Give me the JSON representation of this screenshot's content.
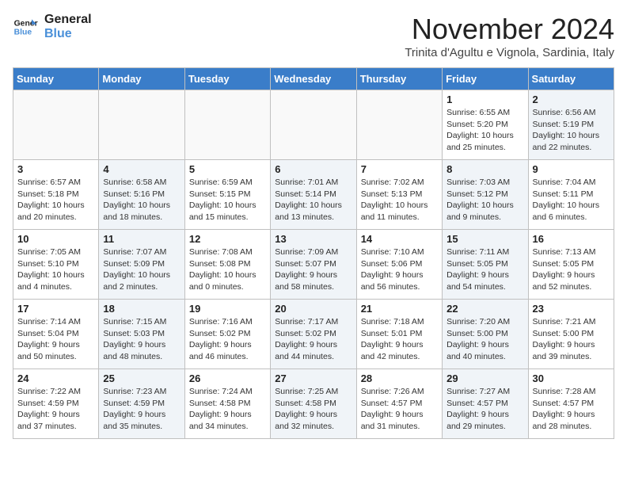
{
  "logo": {
    "line1": "General",
    "line2": "Blue"
  },
  "title": "November 2024",
  "subtitle": "Trinita d'Agultu e Vignola, Sardinia, Italy",
  "headers": [
    "Sunday",
    "Monday",
    "Tuesday",
    "Wednesday",
    "Thursday",
    "Friday",
    "Saturday"
  ],
  "weeks": [
    [
      {
        "day": "",
        "info": "",
        "shaded": false,
        "empty": true
      },
      {
        "day": "",
        "info": "",
        "shaded": false,
        "empty": true
      },
      {
        "day": "",
        "info": "",
        "shaded": false,
        "empty": true
      },
      {
        "day": "",
        "info": "",
        "shaded": false,
        "empty": true
      },
      {
        "day": "",
        "info": "",
        "shaded": false,
        "empty": true
      },
      {
        "day": "1",
        "info": "Sunrise: 6:55 AM\nSunset: 5:20 PM\nDaylight: 10 hours and 25 minutes.",
        "shaded": false,
        "empty": false
      },
      {
        "day": "2",
        "info": "Sunrise: 6:56 AM\nSunset: 5:19 PM\nDaylight: 10 hours and 22 minutes.",
        "shaded": true,
        "empty": false
      }
    ],
    [
      {
        "day": "3",
        "info": "Sunrise: 6:57 AM\nSunset: 5:18 PM\nDaylight: 10 hours and 20 minutes.",
        "shaded": false,
        "empty": false
      },
      {
        "day": "4",
        "info": "Sunrise: 6:58 AM\nSunset: 5:16 PM\nDaylight: 10 hours and 18 minutes.",
        "shaded": true,
        "empty": false
      },
      {
        "day": "5",
        "info": "Sunrise: 6:59 AM\nSunset: 5:15 PM\nDaylight: 10 hours and 15 minutes.",
        "shaded": false,
        "empty": false
      },
      {
        "day": "6",
        "info": "Sunrise: 7:01 AM\nSunset: 5:14 PM\nDaylight: 10 hours and 13 minutes.",
        "shaded": true,
        "empty": false
      },
      {
        "day": "7",
        "info": "Sunrise: 7:02 AM\nSunset: 5:13 PM\nDaylight: 10 hours and 11 minutes.",
        "shaded": false,
        "empty": false
      },
      {
        "day": "8",
        "info": "Sunrise: 7:03 AM\nSunset: 5:12 PM\nDaylight: 10 hours and 9 minutes.",
        "shaded": true,
        "empty": false
      },
      {
        "day": "9",
        "info": "Sunrise: 7:04 AM\nSunset: 5:11 PM\nDaylight: 10 hours and 6 minutes.",
        "shaded": false,
        "empty": false
      }
    ],
    [
      {
        "day": "10",
        "info": "Sunrise: 7:05 AM\nSunset: 5:10 PM\nDaylight: 10 hours and 4 minutes.",
        "shaded": false,
        "empty": false
      },
      {
        "day": "11",
        "info": "Sunrise: 7:07 AM\nSunset: 5:09 PM\nDaylight: 10 hours and 2 minutes.",
        "shaded": true,
        "empty": false
      },
      {
        "day": "12",
        "info": "Sunrise: 7:08 AM\nSunset: 5:08 PM\nDaylight: 10 hours and 0 minutes.",
        "shaded": false,
        "empty": false
      },
      {
        "day": "13",
        "info": "Sunrise: 7:09 AM\nSunset: 5:07 PM\nDaylight: 9 hours and 58 minutes.",
        "shaded": true,
        "empty": false
      },
      {
        "day": "14",
        "info": "Sunrise: 7:10 AM\nSunset: 5:06 PM\nDaylight: 9 hours and 56 minutes.",
        "shaded": false,
        "empty": false
      },
      {
        "day": "15",
        "info": "Sunrise: 7:11 AM\nSunset: 5:05 PM\nDaylight: 9 hours and 54 minutes.",
        "shaded": true,
        "empty": false
      },
      {
        "day": "16",
        "info": "Sunrise: 7:13 AM\nSunset: 5:05 PM\nDaylight: 9 hours and 52 minutes.",
        "shaded": false,
        "empty": false
      }
    ],
    [
      {
        "day": "17",
        "info": "Sunrise: 7:14 AM\nSunset: 5:04 PM\nDaylight: 9 hours and 50 minutes.",
        "shaded": false,
        "empty": false
      },
      {
        "day": "18",
        "info": "Sunrise: 7:15 AM\nSunset: 5:03 PM\nDaylight: 9 hours and 48 minutes.",
        "shaded": true,
        "empty": false
      },
      {
        "day": "19",
        "info": "Sunrise: 7:16 AM\nSunset: 5:02 PM\nDaylight: 9 hours and 46 minutes.",
        "shaded": false,
        "empty": false
      },
      {
        "day": "20",
        "info": "Sunrise: 7:17 AM\nSunset: 5:02 PM\nDaylight: 9 hours and 44 minutes.",
        "shaded": true,
        "empty": false
      },
      {
        "day": "21",
        "info": "Sunrise: 7:18 AM\nSunset: 5:01 PM\nDaylight: 9 hours and 42 minutes.",
        "shaded": false,
        "empty": false
      },
      {
        "day": "22",
        "info": "Sunrise: 7:20 AM\nSunset: 5:00 PM\nDaylight: 9 hours and 40 minutes.",
        "shaded": true,
        "empty": false
      },
      {
        "day": "23",
        "info": "Sunrise: 7:21 AM\nSunset: 5:00 PM\nDaylight: 9 hours and 39 minutes.",
        "shaded": false,
        "empty": false
      }
    ],
    [
      {
        "day": "24",
        "info": "Sunrise: 7:22 AM\nSunset: 4:59 PM\nDaylight: 9 hours and 37 minutes.",
        "shaded": false,
        "empty": false
      },
      {
        "day": "25",
        "info": "Sunrise: 7:23 AM\nSunset: 4:59 PM\nDaylight: 9 hours and 35 minutes.",
        "shaded": true,
        "empty": false
      },
      {
        "day": "26",
        "info": "Sunrise: 7:24 AM\nSunset: 4:58 PM\nDaylight: 9 hours and 34 minutes.",
        "shaded": false,
        "empty": false
      },
      {
        "day": "27",
        "info": "Sunrise: 7:25 AM\nSunset: 4:58 PM\nDaylight: 9 hours and 32 minutes.",
        "shaded": true,
        "empty": false
      },
      {
        "day": "28",
        "info": "Sunrise: 7:26 AM\nSunset: 4:57 PM\nDaylight: 9 hours and 31 minutes.",
        "shaded": false,
        "empty": false
      },
      {
        "day": "29",
        "info": "Sunrise: 7:27 AM\nSunset: 4:57 PM\nDaylight: 9 hours and 29 minutes.",
        "shaded": true,
        "empty": false
      },
      {
        "day": "30",
        "info": "Sunrise: 7:28 AM\nSunset: 4:57 PM\nDaylight: 9 hours and 28 minutes.",
        "shaded": false,
        "empty": false
      }
    ]
  ]
}
